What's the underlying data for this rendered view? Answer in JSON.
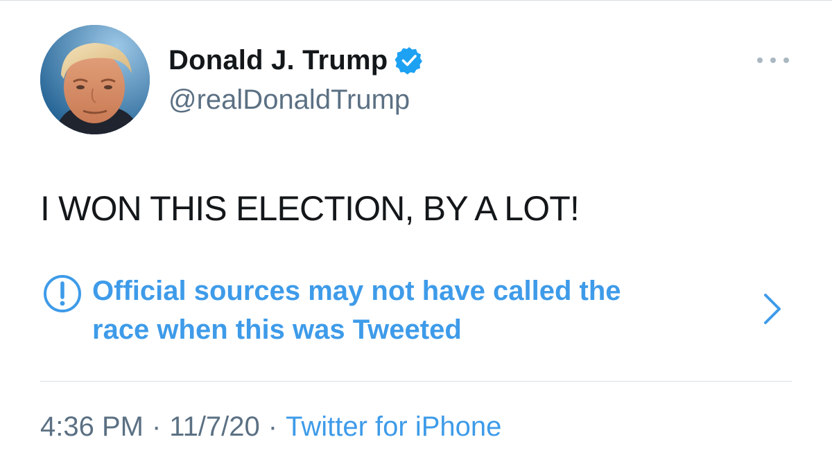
{
  "user": {
    "display_name": "Donald J. Trump",
    "handle": "@realDonaldTrump",
    "verified": true,
    "avatar_icon": "profile-photo"
  },
  "tweet": {
    "text": "I WON THIS ELECTION, BY A LOT!"
  },
  "notice": {
    "line1": "Official sources may not have called the",
    "line2": "race when this was Tweeted",
    "icon": "exclamation-circle-icon"
  },
  "meta": {
    "time": "4:36 PM",
    "separator": "·",
    "date": "11/7/20",
    "source": "Twitter for iPhone"
  },
  "colors": {
    "link_blue": "#3e9be9",
    "verified_blue": "#1da1f2",
    "text_dark": "#14171a",
    "text_gray": "#5b7083"
  }
}
